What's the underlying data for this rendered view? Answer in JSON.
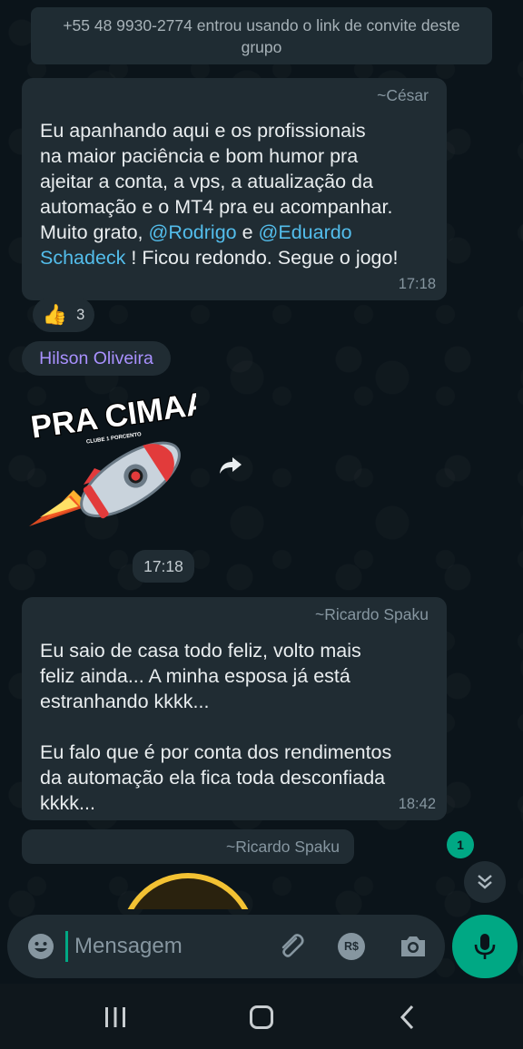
{
  "system_message": "+55 48 9930-2774 entrou usando o link de convite deste grupo",
  "messages": [
    {
      "sender": "~César",
      "body_prefix": "Eu apanhando aqui e os profissionais\nna maior paciência e bom humor pra\najeitar a conta, a vps, a atualização da\nautomação e o MT4 pra eu acompanhar.\nMuito grato, ",
      "mention1": "@Rodrigo",
      "connector": " e ",
      "mention2": "@Eduardo\nSchadeck",
      "body_suffix": " ! Ficou redondo. Segue o jogo!",
      "time": "17:18",
      "reaction_emoji": "👍",
      "reaction_count": "3"
    },
    {
      "sender": "Hilson Oliveira",
      "sticker_text": "PRA CIMAAA!",
      "sticker_subtext": "CLUBE 1 PORCENTO",
      "time": "17:18"
    },
    {
      "sender": "~Ricardo Spaku",
      "body": "Eu saio de casa todo feliz, volto mais\nfeliz ainda... A minha esposa já está\nestranhando kkkk...\n\nEu falo que é por conta dos rendimentos\nda automação ela fica toda desconfiada\nkkkk...",
      "time": "18:42"
    },
    {
      "sender": "~Ricardo Spaku"
    }
  ],
  "unread_count": "1",
  "input": {
    "placeholder": "Mensagem",
    "payment_label": "R$"
  },
  "colors": {
    "accent": "#00a884",
    "bubble": "#202c33",
    "background": "#0b141a",
    "mention": "#53bdeb",
    "sender_name": "#a991ff"
  }
}
